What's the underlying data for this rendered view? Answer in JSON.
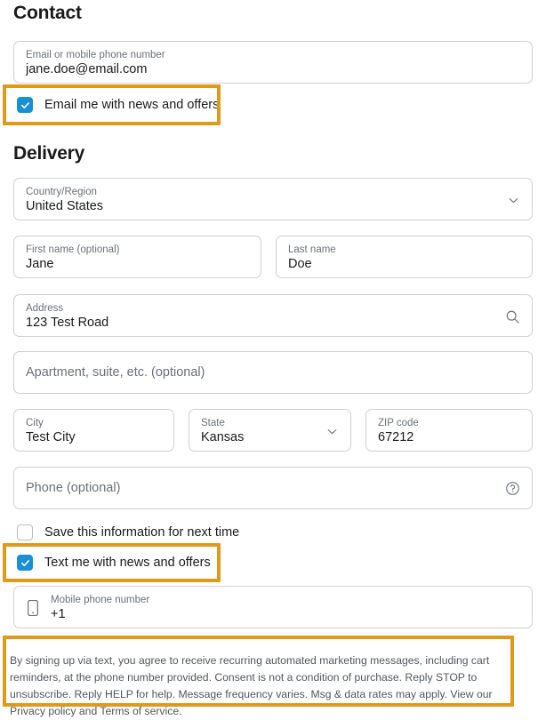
{
  "contact": {
    "heading": "Contact",
    "email": {
      "label": "Email or mobile phone number",
      "value": "jane.doe@email.com"
    },
    "email_optin": {
      "label": "Email me with news and offers",
      "checked": "true"
    }
  },
  "delivery": {
    "heading": "Delivery",
    "country": {
      "label": "Country/Region",
      "value": "United States",
      "icon": "chevron-down-icon"
    },
    "first_name": {
      "label": "First name (optional)",
      "value": "Jane"
    },
    "last_name": {
      "label": "Last name",
      "value": "Doe"
    },
    "address": {
      "label": "Address",
      "value": "123 Test Road",
      "icon": "search-icon"
    },
    "apartment": {
      "placeholder": "Apartment, suite, etc. (optional)",
      "value": ""
    },
    "city": {
      "label": "City",
      "value": "Test City"
    },
    "state": {
      "label": "State",
      "value": "Kansas",
      "icon": "chevron-down-icon"
    },
    "zip": {
      "label": "ZIP code",
      "value": "67212"
    },
    "phone": {
      "placeholder": "Phone (optional)",
      "value": "",
      "icon": "help-circle-icon"
    },
    "save_info": {
      "label": "Save this information for next time",
      "checked": "false"
    },
    "text_optin": {
      "label": "Text me with news and offers",
      "checked": "true"
    },
    "mobile_phone": {
      "label": "Mobile phone number",
      "value": "+1",
      "icon": "mobile-device-icon"
    },
    "disclaimer": "By signing up via text, you agree to receive recurring automated marketing messages, including cart reminders, at the phone number provided. Consent is not a condition of purchase. Reply STOP to unsubscribe. Reply HELP for help. Message frequency varies. Msg & data rates may apply. View our Privacy policy and Terms of service."
  },
  "colors": {
    "highlight_border": "#e09a1a",
    "checkbox_checked": "#1a8fd1",
    "field_border": "#d0d0d0",
    "label_text": "#6b7177",
    "value_text": "#1a1a1a"
  }
}
